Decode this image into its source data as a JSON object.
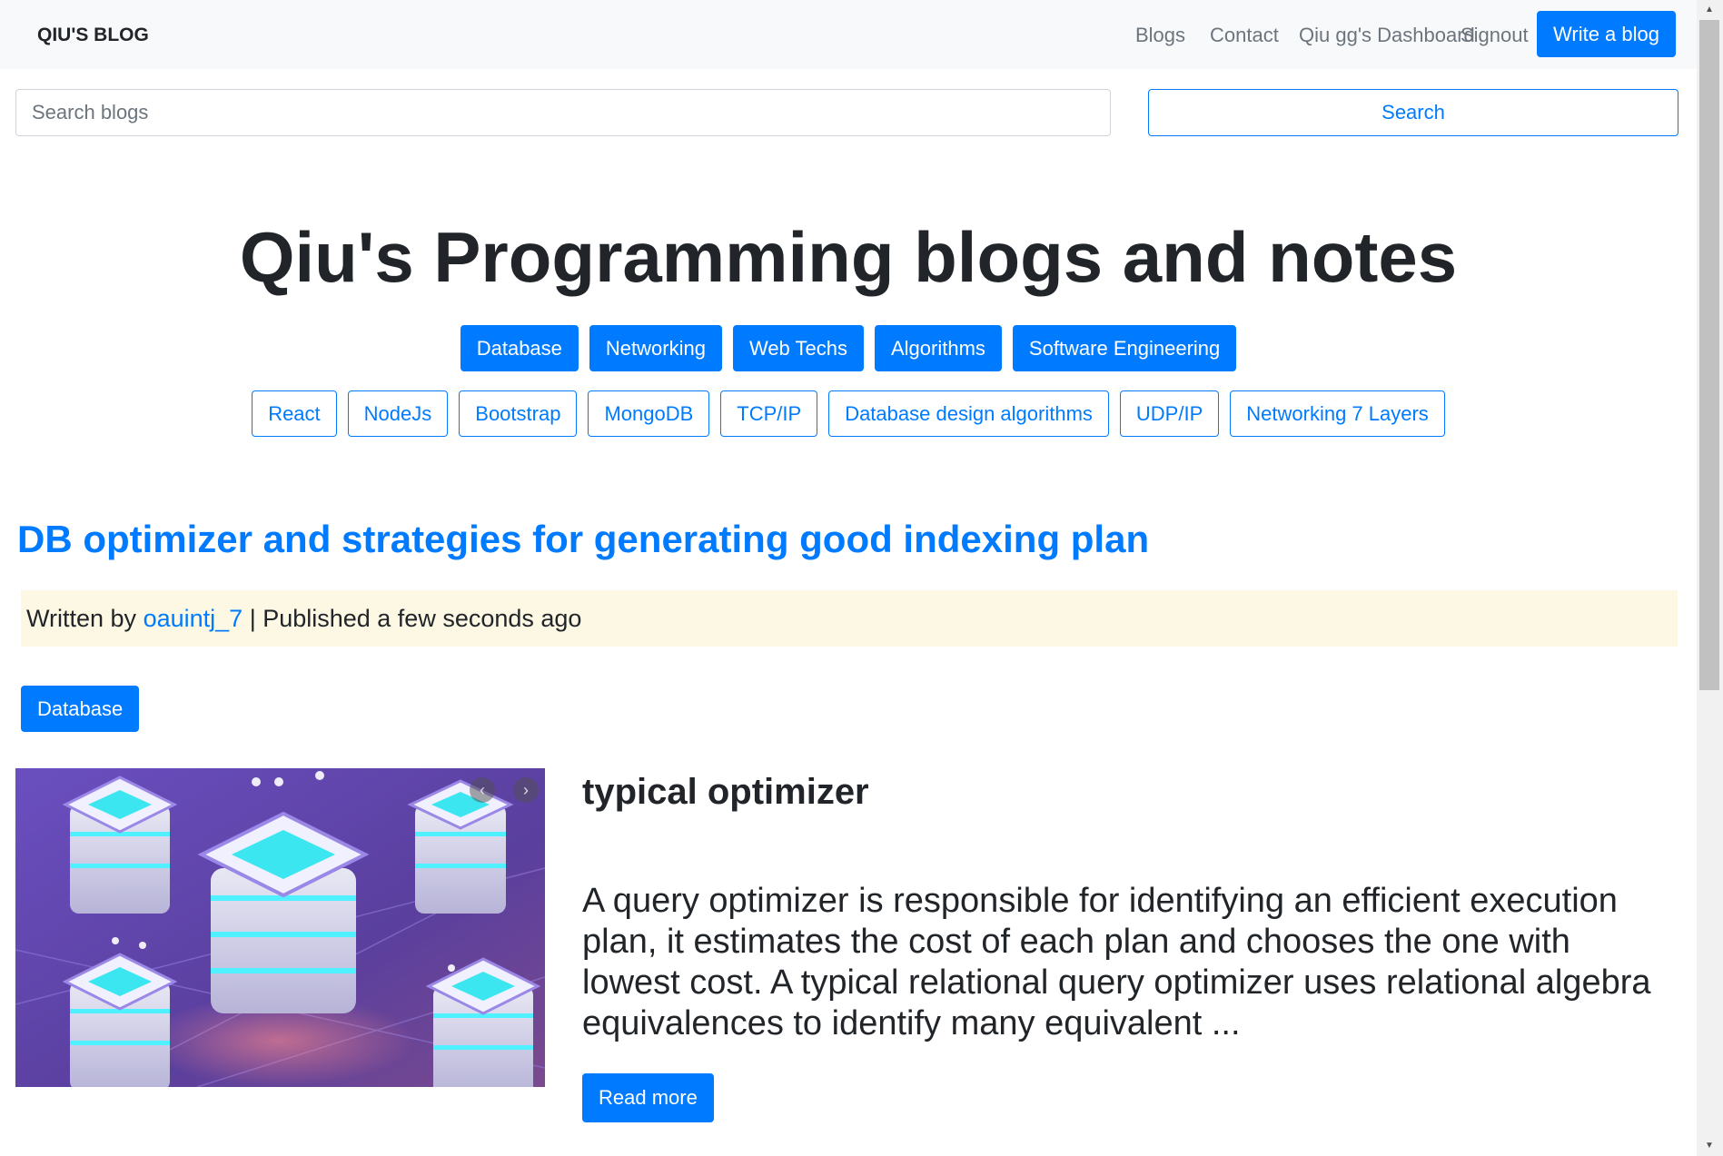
{
  "navbar": {
    "brand": "QIU'S BLOG",
    "links": [
      "Blogs",
      "Contact",
      "Qiu gg's Dashboard",
      "Signout"
    ],
    "write_button": "Write a blog"
  },
  "search": {
    "placeholder": "Search blogs",
    "button": "Search"
  },
  "hero": {
    "title": "Qiu's Programming blogs and notes"
  },
  "categories": [
    "Database",
    "Networking",
    "Web Techs",
    "Algorithms",
    "Software Engineering"
  ],
  "tags": [
    "React",
    "NodeJs",
    "Bootstrap",
    "MongoDB",
    "TCP/IP",
    "Database design algorithms",
    "UDP/IP",
    "Networking 7 Layers"
  ],
  "post": {
    "title": "DB optimizer and strategies for generating good indexing plan",
    "meta_prefix": "Written by",
    "author": "oauintj_7",
    "meta_suffix": "| Published a few seconds ago",
    "category": "Database",
    "subtitle": "typical optimizer",
    "excerpt": "A query optimizer is responsible for identifying an efficient execution plan, it estimates the cost of each plan and chooses the one with lowest cost. A typical relational query optimizer uses relational algebra equivalences to identify many equivalent ...",
    "read_more": "Read more"
  },
  "colors": {
    "primary": "#007bff",
    "navbar_bg": "#f8f9fa",
    "meta_bg": "#fcf8e3",
    "illustration_bg": "#5a3f9e"
  }
}
